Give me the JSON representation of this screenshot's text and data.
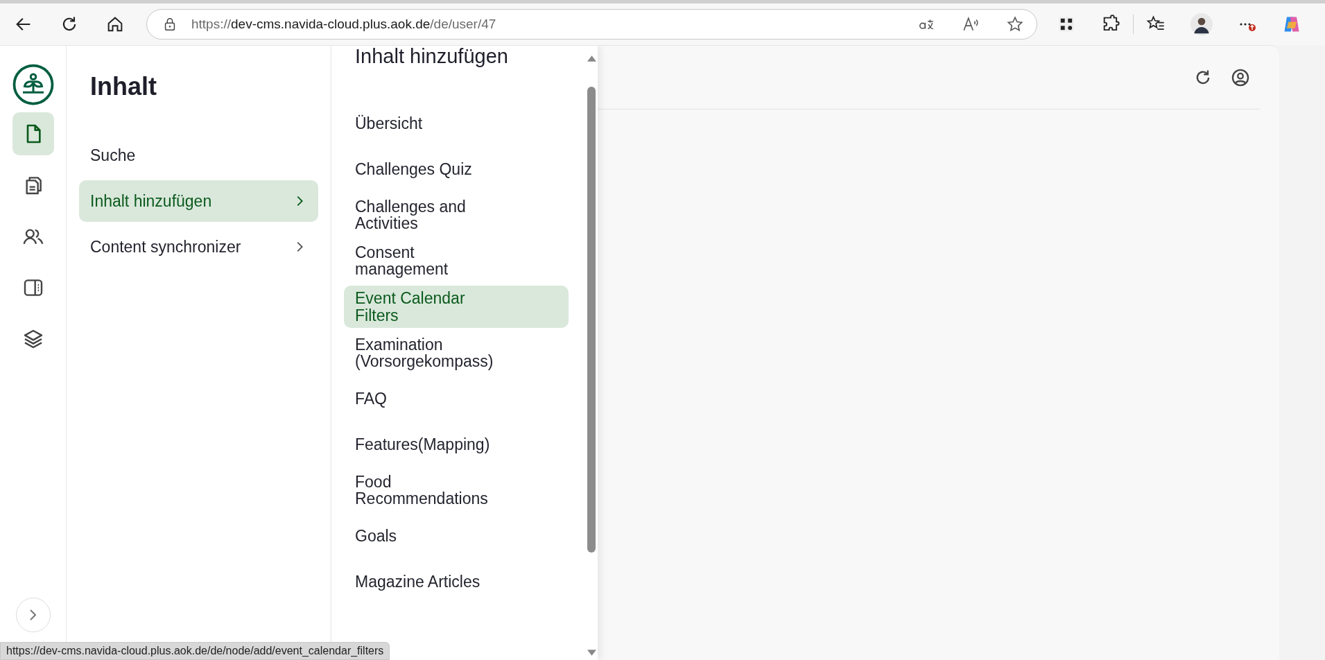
{
  "browser": {
    "url_scheme": "https://",
    "url_host": "dev-cms.navida-cloud.plus.aok.de",
    "url_path": "/de/user/47"
  },
  "rail": [
    {
      "kind": "file",
      "selected": true
    },
    {
      "kind": "files",
      "selected": false
    },
    {
      "kind": "users",
      "selected": false
    },
    {
      "kind": "panel",
      "selected": false
    },
    {
      "kind": "layers",
      "selected": false
    }
  ],
  "menu": {
    "title": "Inhalt",
    "items": [
      {
        "label": "Suche",
        "selected": false,
        "has_submenu": false
      },
      {
        "label": "Inhalt hinzufügen",
        "selected": true,
        "has_submenu": true
      },
      {
        "label": "Content synchronizer",
        "selected": false,
        "has_submenu": true
      }
    ]
  },
  "submenu": {
    "title": "Inhalt hinzufügen",
    "items": [
      {
        "label": "Übersicht",
        "selected": false
      },
      {
        "label": "Challenges Quiz",
        "selected": false
      },
      {
        "label": "Challenges and Activities",
        "selected": false
      },
      {
        "label": "Consent management",
        "selected": false
      },
      {
        "label": "Event Calendar Filters",
        "selected": true
      },
      {
        "label": "Examination (Vorsorgekompass)",
        "selected": false
      },
      {
        "label": "FAQ",
        "selected": false
      },
      {
        "label": "Features(Mapping)",
        "selected": false
      },
      {
        "label": "Food Recommendations",
        "selected": false
      },
      {
        "label": "Goals",
        "selected": false
      },
      {
        "label": "Magazine Articles",
        "selected": false
      }
    ]
  },
  "status_bar": {
    "url": "https://dev-cms.navida-cloud.plus.aok.de/de/node/add/event_calendar_filters"
  }
}
